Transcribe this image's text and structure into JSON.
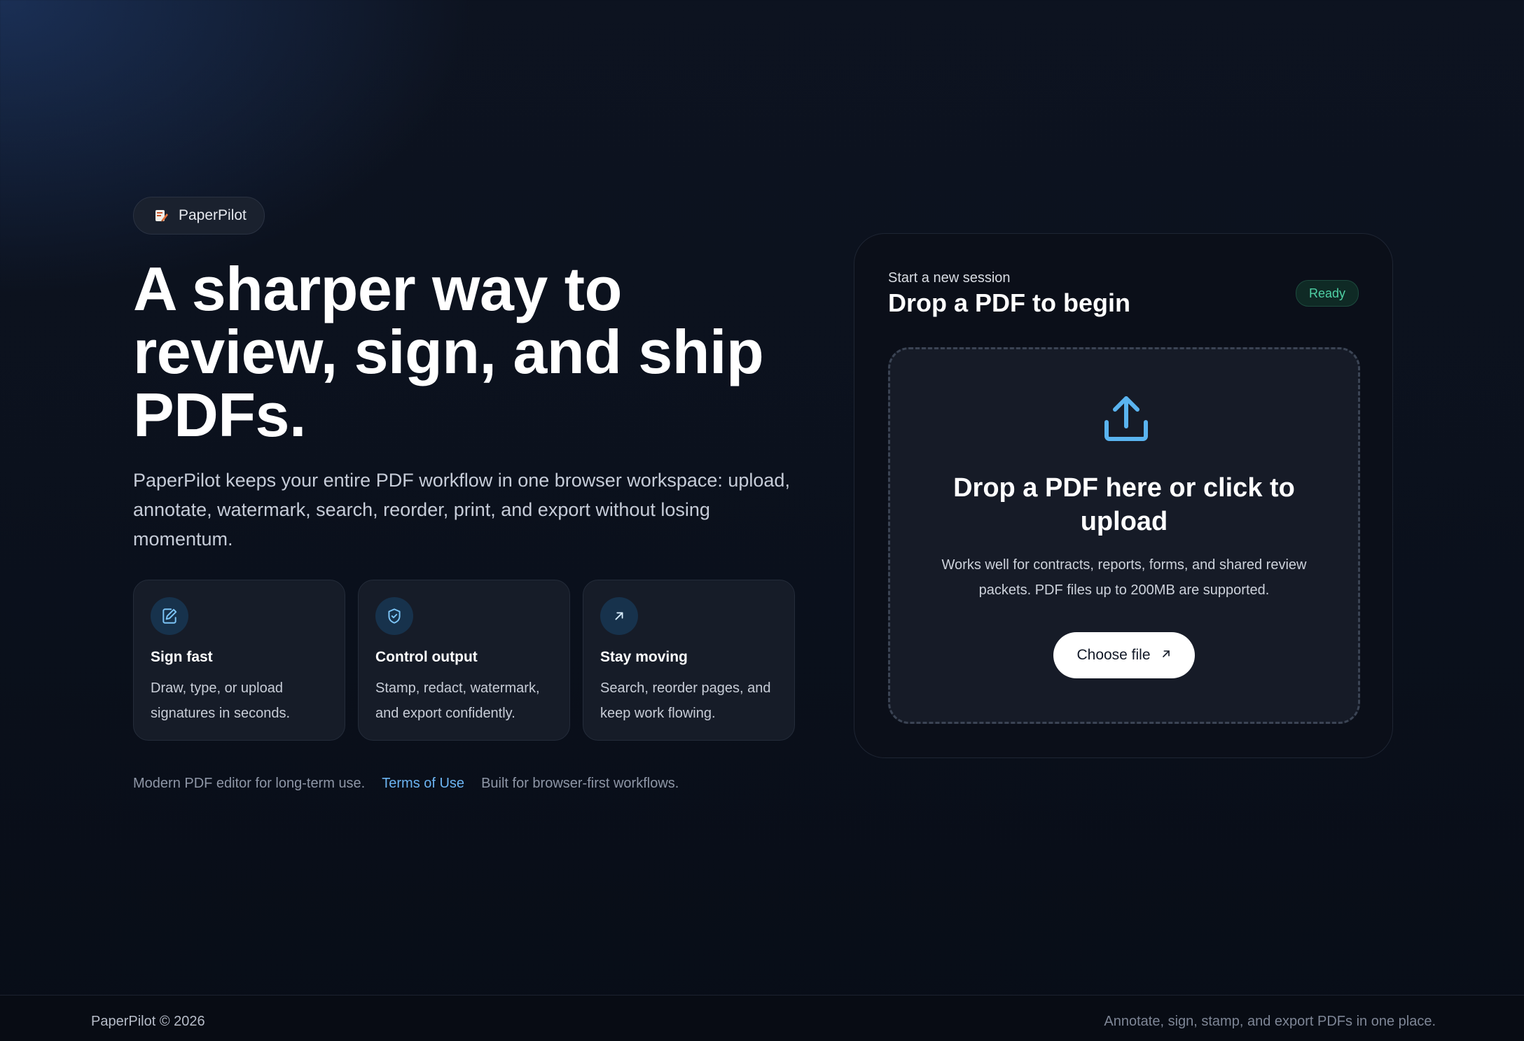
{
  "brand": {
    "name": "PaperPilot",
    "logo_icon": "paperpilot-logo-icon"
  },
  "hero": {
    "title": "A sharper way to review, sign, and ship PDFs.",
    "description": "PaperPilot keeps your entire PDF workflow in one browser workspace: upload, annotate, watermark, search, reorder, print, and export without losing momentum."
  },
  "features": [
    {
      "icon": "signature-edit-icon",
      "title": "Sign fast",
      "text": "Draw, type, or upload signatures in seconds."
    },
    {
      "icon": "shield-check-icon",
      "title": "Control output",
      "text": "Stamp, redact, watermark, and export confidently."
    },
    {
      "icon": "arrow-up-right-icon",
      "title": "Stay moving",
      "text": "Search, reorder pages, and keep work flowing."
    }
  ],
  "footnote": {
    "left": "Modern PDF editor for long-term use.",
    "link": "Terms of Use",
    "right": "Built for browser-first workflows."
  },
  "upload": {
    "eyebrow": "Start a new session",
    "title": "Drop a PDF to begin",
    "status": "Ready",
    "drop_title": "Drop a PDF here or click to upload",
    "drop_desc": "Works well for contracts, reports, forms, and shared review packets. PDF files up to 200MB are supported.",
    "button_label": "Choose file",
    "icon": "upload-icon"
  },
  "footer": {
    "copyright": "PaperPilot © 2026",
    "tagline": "Annotate, sign, stamp, and export PDFs in one place."
  },
  "colors": {
    "accent": "#5ab4f0",
    "status_green": "#4fd1a5",
    "link": "#6cb4f2",
    "background": "#0b111d"
  }
}
